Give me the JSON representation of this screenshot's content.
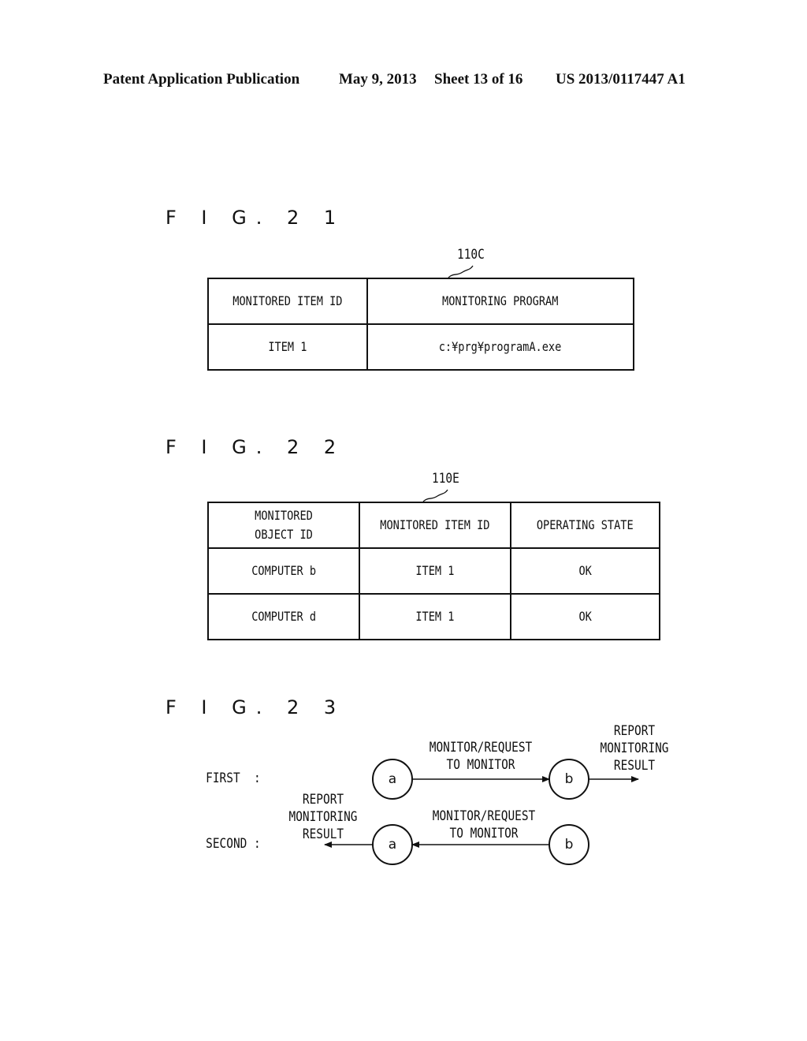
{
  "header": {
    "publication": "Patent Application Publication",
    "date": "May 9, 2013",
    "sheet": "Sheet 13 of 16",
    "number": "US 2013/0117447 A1"
  },
  "fig21": {
    "title": "F I G. 2 1",
    "ref": "110C",
    "columns": [
      "MONITORED ITEM ID",
      "MONITORING PROGRAM"
    ],
    "rows": [
      [
        "ITEM 1",
        "c:¥prg¥programA.exe"
      ]
    ]
  },
  "fig22": {
    "title": "F I G. 2 2",
    "ref": "110E",
    "columns": [
      "MONITORED\nOBJECT ID",
      "MONITORED ITEM ID",
      "OPERATING STATE"
    ],
    "col0_lines": [
      "MONITORED",
      "OBJECT ID"
    ],
    "rows": [
      [
        "COMPUTER b",
        "ITEM 1",
        "OK"
      ],
      [
        "COMPUTER d",
        "ITEM 1",
        "OK"
      ]
    ]
  },
  "fig23": {
    "title": "F I G. 2 3",
    "first": {
      "label": "FIRST  :",
      "node_a": "a",
      "node_b": "b",
      "edge_label": [
        "MONITOR/REQUEST",
        "TO MONITOR"
      ],
      "out_label": [
        "REPORT",
        "MONITORING",
        "RESULT"
      ]
    },
    "second": {
      "label": "SECOND :",
      "node_a": "a",
      "node_b": "b",
      "edge_label": [
        "MONITOR/REQUEST",
        "TO MONITOR"
      ],
      "out_label": [
        "REPORT",
        "MONITORING",
        "RESULT"
      ]
    }
  }
}
